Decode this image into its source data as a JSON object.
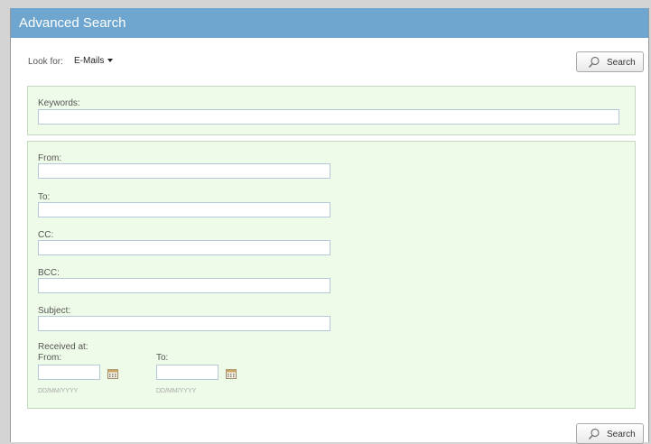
{
  "window": {
    "title": "Advanced Search"
  },
  "lookfor": {
    "label": "Look for:",
    "value": "E-Mails"
  },
  "search_button": {
    "label": "Search"
  },
  "keywords": {
    "label": "Keywords:",
    "value": ""
  },
  "fields": {
    "from": {
      "label": "From:",
      "value": ""
    },
    "to": {
      "label": "To:",
      "value": ""
    },
    "cc": {
      "label": "CC:",
      "value": ""
    },
    "bcc": {
      "label": "BCC:",
      "value": ""
    },
    "subject": {
      "label": "Subject:",
      "value": ""
    }
  },
  "received": {
    "label": "Received at:",
    "from_label": "From:",
    "to_label": "To:",
    "date_hint": "DD/MM/YYYY",
    "from_value": "",
    "to_value": ""
  },
  "icons": {
    "search": "magnifier-icon",
    "calendar": "calendar-icon",
    "dropdown": "caret-down-icon"
  },
  "colors": {
    "titlebar": "#6ea6cf",
    "panel_bg": "#eefbe8",
    "panel_border": "#c6d8c0"
  }
}
